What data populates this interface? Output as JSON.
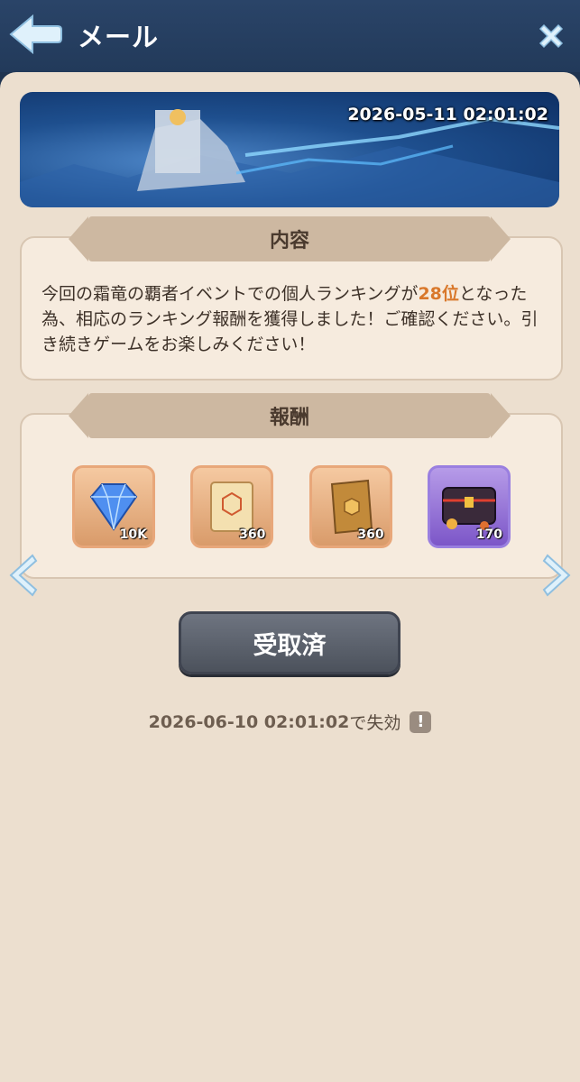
{
  "header": {
    "title": "メール"
  },
  "banner": {
    "date": "2026-05-11 02:01:02"
  },
  "content_section": {
    "heading": "内容",
    "text_before": "今回の霜竜の覇者イベントでの個人ランキングが",
    "rank": "28位",
    "text_after": "となった為、相応のランキング報酬を獲得しました！ご確認ください。引き続きゲームをお楽しみください！"
  },
  "reward_section": {
    "heading": "報酬",
    "items": [
      {
        "icon": "diamond-icon",
        "count": "10K"
      },
      {
        "icon": "scroll-icon",
        "count": "360"
      },
      {
        "icon": "book-icon",
        "count": "360"
      },
      {
        "icon": "treasure-chest-icon",
        "count": "170"
      }
    ]
  },
  "claim_button": {
    "label": "受取済"
  },
  "expiry": {
    "datetime": "2026-06-10 02:01:02",
    "suffix": "で失効",
    "info_icon": "!"
  },
  "colors": {
    "accent_rank": "#d9782b",
    "panel_bg": "#ecdfcf",
    "header_bg": "#223a5a"
  }
}
